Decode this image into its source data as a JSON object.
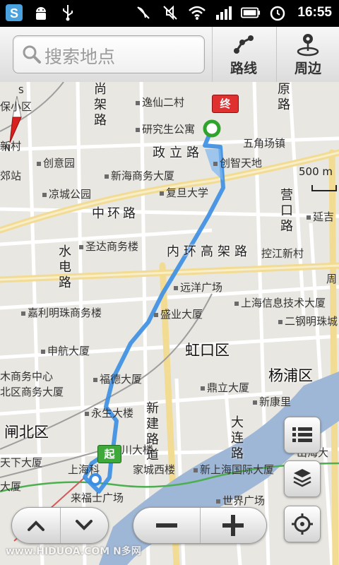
{
  "status_bar": {
    "time": "16:55",
    "left_icons": [
      "app-s-icon",
      "android-debug-icon",
      "usb-icon"
    ],
    "right_icons": [
      "no-signal-icon",
      "silent-icon",
      "wifi-icon",
      "signal-icon",
      "battery-icon",
      "alarm-icon"
    ]
  },
  "search": {
    "placeholder": "搜索地点"
  },
  "toolbar": {
    "route_label": "路线",
    "nearby_label": "周边"
  },
  "map": {
    "scale_label": "500 m",
    "markers": {
      "end_label": "终",
      "start_label": "起"
    },
    "districts": {
      "hongkou": "虹口区",
      "yangpu": "杨浦区",
      "zhabei": "闸北区"
    },
    "roads": {
      "zhengli": "政立路",
      "zhonghuan": "中环路",
      "neihuan": "内环高架路",
      "shuidian": "水电路",
      "yuanlu": "原路",
      "yingkou": "营口路",
      "xinjian": "新建路道",
      "dalian": "大连路",
      "shangsheng": "尚架路"
    },
    "pois": {
      "yixian": "逸仙二村",
      "yanjiusheng": "研究生公寓",
      "wujiaochang": "五角场镇",
      "chuangzhi": "创智天地",
      "chuangyi": "创意园",
      "xinhai": "新海商务大厦",
      "fudan": "复旦大学",
      "liangcheng": "凉城公园",
      "yanji": "延吉",
      "shengda": "圣达商务楼",
      "kongjiang": "控江新村",
      "yuanyang": "远洋广场",
      "jiali": "嘉利明珠商务楼",
      "shanghai_info": "上海信息技术大厦",
      "shengye": "盛业大厦",
      "ergang": "二钢明珠城",
      "shenhang": "申航大厦",
      "fude": "福德大厦",
      "dingli": "鼎立大厦",
      "yongsheng": "永生大楼",
      "xinkang": "新康里",
      "dalou": "川大楼",
      "jiacheng": "家城西楼",
      "xinshanghai": "新上海国际大厦",
      "shanghaike": "上海科",
      "laifushi": "来福士广场",
      "shijie": "世界广场",
      "tianxia": "天下大厦",
      "wuxi": "木商务中心",
      "beiqu": "北区商务大厦",
      "baoxiao": "保小区",
      "xincun": "新村",
      "jiaozhan": "郊站",
      "zhoubian": "周",
      "shanhai": "山海大",
      "dasha": "大厦",
      "yan": "延吉"
    },
    "compass": {
      "north": "N",
      "south": "S"
    }
  },
  "controls": {
    "layers_icon": "list-icon",
    "map_layer_icon": "layers-icon",
    "locate_icon": "locate-icon",
    "pan_up_icon": "chevron-up-icon",
    "pan_down_icon": "chevron-down-icon",
    "zoom_out_icon": "minus-icon",
    "zoom_in_icon": "plus-icon"
  },
  "watermark": "www.HIDUOA.COM N多网",
  "colors": {
    "route": "#3b8ee3",
    "end_flag": "#e03131",
    "start_flag": "#3fa83b",
    "river": "#9fb7d6",
    "road_major": "#f6e3a8",
    "road_minor": "#ffffff",
    "rail_green": "#4caf50"
  }
}
